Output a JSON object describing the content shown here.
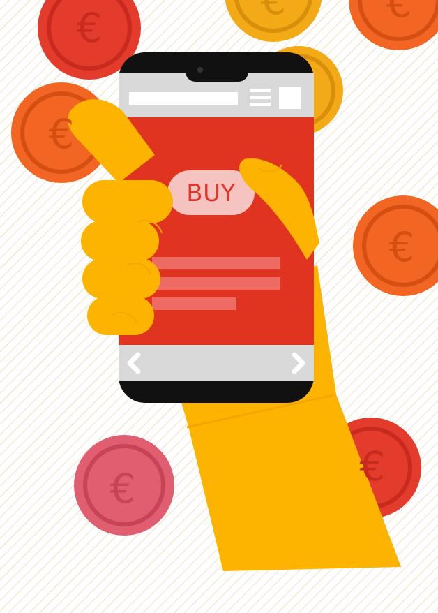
{
  "currency_symbol": "€",
  "phone": {
    "buy_label": "BUY",
    "body_color": "#111111",
    "screen_color": "#e03320",
    "bar_color": "#d9d9d9",
    "line_color": "#ee6b63",
    "buy_bg_color": "#f5c3c0"
  },
  "hand": {
    "color": "#fdb400",
    "knuckle_color": "#f3a600"
  },
  "background": {
    "base_color": "#ffffff",
    "stripe_color": "#f4ead8"
  },
  "coin_colors": {
    "red": "#e43c2c",
    "orange": "#f26522",
    "gold": "#f4a916",
    "pink": "#e15d70"
  }
}
